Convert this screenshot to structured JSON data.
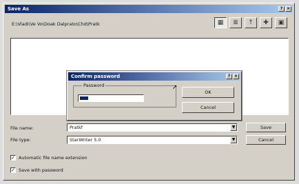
{
  "window": {
    "title": "Save As",
    "path": "E:\\Vladi\\Ve Vo\\Doak Dalprato\\Chd\\Pratk"
  },
  "toolbar": {
    "icons": [
      "list-view-icon",
      "details-view-icon",
      "up-folder-icon",
      "new-folder-icon",
      "desktop-icon"
    ]
  },
  "fields": {
    "filename_label": "File name:",
    "filename_value": "Pratkf",
    "filetype_label": "File type:",
    "filetype_value": "StarWriter 5.0"
  },
  "buttons": {
    "save": "Save",
    "cancel": "Cancel"
  },
  "checks": {
    "auto_ext": "Automatic file name extension",
    "save_pw": "Save with password"
  },
  "modal": {
    "title": "Confirm password",
    "group_label": "Password",
    "ok": "OK",
    "cancel": "Cancel"
  }
}
